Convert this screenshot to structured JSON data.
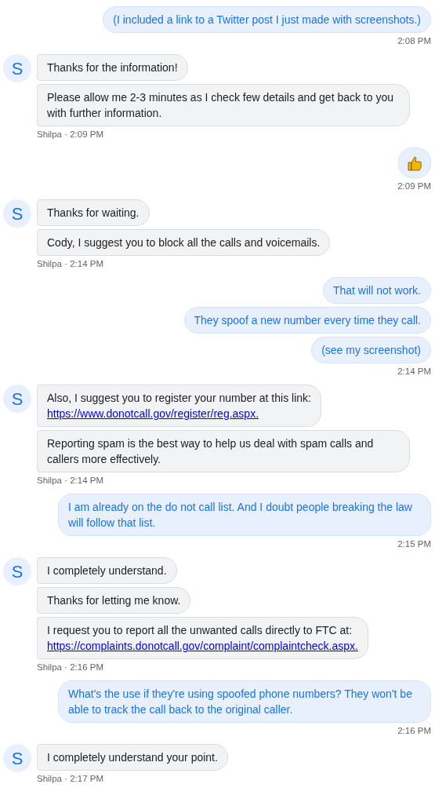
{
  "conversation": [
    {
      "kind": "user",
      "messages": [
        {
          "kind": "text",
          "text": "(I included a link to a Twitter post I just made with screenshots.)"
        }
      ],
      "meta": "2:08 PM"
    },
    {
      "kind": "agent",
      "avatar": "S",
      "messages": [
        {
          "kind": "text",
          "text": "Thanks for the information!"
        },
        {
          "kind": "text",
          "text": "Please allow me 2-3 minutes as I check few details and get back to you with further information."
        }
      ],
      "meta": "Shilpa · 2:09 PM"
    },
    {
      "kind": "user",
      "messages": [
        {
          "kind": "thumbs-up"
        }
      ],
      "meta": "2:09 PM"
    },
    {
      "kind": "agent",
      "avatar": "S",
      "messages": [
        {
          "kind": "text",
          "text": "Thanks for waiting."
        },
        {
          "kind": "text",
          "text": "Cody, I suggest you to block all the calls and voicemails."
        }
      ],
      "meta": "Shilpa · 2:14 PM"
    },
    {
      "kind": "user",
      "messages": [
        {
          "kind": "text",
          "text": "That will not work."
        },
        {
          "kind": "text",
          "text": "They spoof a new number every time they call."
        },
        {
          "kind": "text",
          "text": "(see my screenshot)"
        }
      ],
      "meta": "2:14 PM"
    },
    {
      "kind": "agent",
      "avatar": "S",
      "messages": [
        {
          "kind": "text",
          "text": "Also, I suggest you to register your number at this link:",
          "link": "https://www.donotcall.gov/register/reg.aspx."
        },
        {
          "kind": "text",
          "text": "Reporting spam is the best way to help us deal with spam calls and callers more effectively."
        }
      ],
      "meta": "Shilpa · 2:14 PM"
    },
    {
      "kind": "user",
      "messages": [
        {
          "kind": "text",
          "text": "I am already on the do not call list. And I doubt people breaking the law will follow that list."
        }
      ],
      "meta": "2:15 PM"
    },
    {
      "kind": "agent",
      "avatar": "S",
      "messages": [
        {
          "kind": "text",
          "text": "I completely understand."
        },
        {
          "kind": "text",
          "text": "Thanks for letting me know."
        },
        {
          "kind": "text",
          "text": "I request you to report all the unwanted calls directly to FTC at:",
          "link": "https://complaints.donotcall.gov/complaint/complaintcheck.aspx."
        }
      ],
      "meta": "Shilpa · 2:16 PM"
    },
    {
      "kind": "user",
      "messages": [
        {
          "kind": "text",
          "text": "What's the use if they're using spoofed phone numbers? They won't be able to track the call back to the original caller."
        }
      ],
      "meta": "2:16 PM"
    },
    {
      "kind": "agent",
      "avatar": "S",
      "messages": [
        {
          "kind": "text",
          "text": "I completely understand your point."
        }
      ],
      "meta": "Shilpa · 2:17 PM"
    }
  ]
}
